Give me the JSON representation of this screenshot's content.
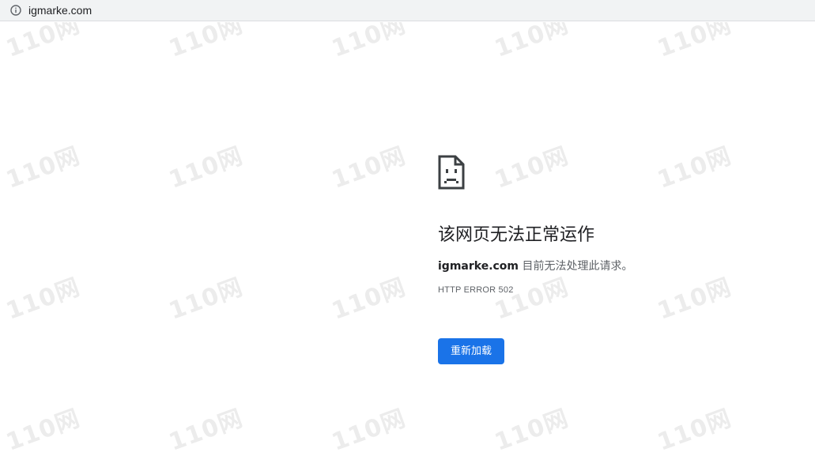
{
  "address_bar": {
    "url": "igmarke.com",
    "icon": "info-circle-icon"
  },
  "watermark": {
    "text": "110网"
  },
  "error_page": {
    "icon": "sad-page-icon",
    "headline": "该网页无法正常运作",
    "host": "igmarke.com",
    "message_suffix": "目前无法处理此请求。",
    "error_code": "HTTP ERROR 502",
    "reload_label": "重新加载"
  },
  "colors": {
    "primary_button": "#1a73e8",
    "omnibox_background": "#f1f3f4",
    "text_primary": "#202124",
    "text_secondary": "#5f6368"
  }
}
